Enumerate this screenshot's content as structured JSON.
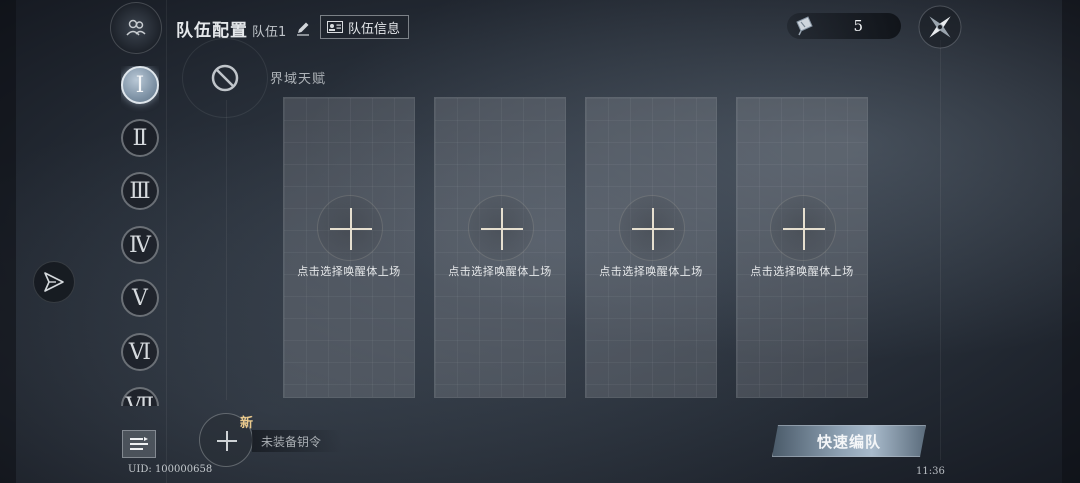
{
  "header": {
    "title": "队伍配置",
    "team_name": "队伍1",
    "team_info_label": "队伍信息"
  },
  "talent": {
    "label": "界域天赋"
  },
  "nav": {
    "items": [
      "Ⅰ",
      "Ⅱ",
      "Ⅲ",
      "Ⅳ",
      "Ⅴ",
      "Ⅵ",
      "Ⅶ"
    ],
    "active_index": 0
  },
  "slots": [
    {
      "label": "点击选择唤醒体上场"
    },
    {
      "label": "点击选择唤醒体上场"
    },
    {
      "label": "点击选择唤醒体上场"
    },
    {
      "label": "点击选择唤醒体上场"
    }
  ],
  "resource": {
    "count": "5"
  },
  "bottom": {
    "uid": "UID: 100000658",
    "new_badge": "新",
    "key_label": "未装备钥令",
    "quick_button": "快速编队",
    "clock": "11:36"
  },
  "icons": {
    "team_emblem": "team-members-icon",
    "edit": "pencil-icon",
    "info": "id-card-icon",
    "talent": "prohibited-icon",
    "send": "paper-plane-icon",
    "ticket": "ticket-icon",
    "compass": "compass-icon",
    "menu": "list-menu-icon"
  },
  "colors": {
    "accent_gold": "#e9c98d",
    "active_nav": "#8fa2b4"
  }
}
